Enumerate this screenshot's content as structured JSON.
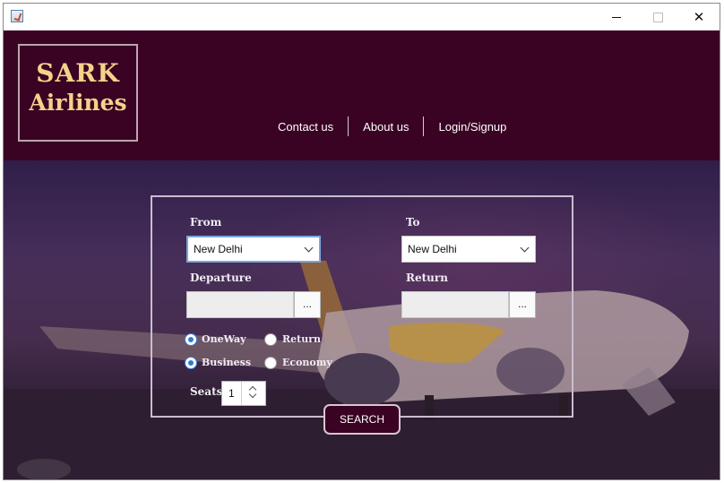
{
  "window": {
    "minimize_symbol": "",
    "maximize_symbol": "",
    "close_symbol": "✕"
  },
  "logo": {
    "line1": "SARK",
    "line2": "Airlines"
  },
  "nav": {
    "items": [
      {
        "label": "Contact us"
      },
      {
        "label": "About us"
      },
      {
        "label": "Login/Signup"
      }
    ]
  },
  "form": {
    "from_label": "From",
    "from_value": "New Delhi",
    "to_label": "To",
    "to_value": "New Delhi",
    "departure_label": "Departure",
    "departure_value": "",
    "departure_button": "...",
    "return_label": "Return",
    "return_value": "",
    "return_button": "...",
    "trip_options": [
      {
        "label": "OneWay",
        "selected": true
      },
      {
        "label": "Return",
        "selected": false
      }
    ],
    "class_options": [
      {
        "label": "Business",
        "selected": true
      },
      {
        "label": "Economy",
        "selected": false
      }
    ],
    "seats_label": "Seats",
    "seats_value": "1",
    "search_label": "SEARCH"
  },
  "colors": {
    "header_bg": "#3a0323",
    "logo_text": "#f3d38a",
    "radio_selected": "#2f7ad8"
  },
  "icons": {
    "app": "java-app-icon",
    "dropdown": "chevron-down-icon",
    "spinner_up": "chevron-up-icon",
    "spinner_down": "chevron-down-icon"
  }
}
